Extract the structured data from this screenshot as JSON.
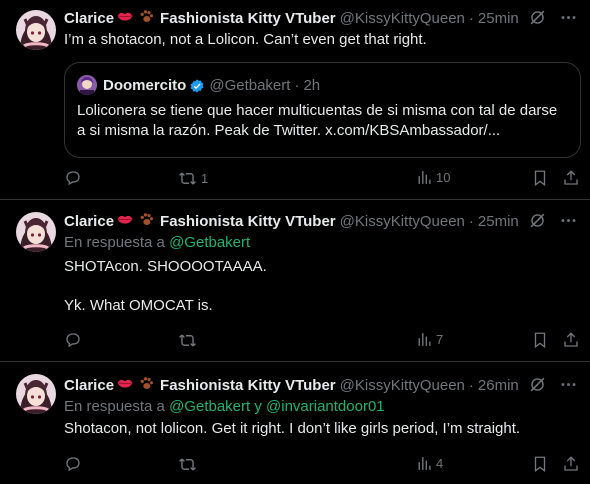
{
  "tweets": [
    {
      "author": {
        "name": "Clarice",
        "display_suffix": "Fashionista Kitty VTuber",
        "handle": "@KissyKittyQueen"
      },
      "time": "25min",
      "text": "I’m a shotacon, not a Lolicon.  Can’t even get that right.",
      "quote": {
        "author": "Doomercito",
        "handle": "@Getbakert",
        "time": "2h",
        "text": "Loliconera se tiene que hacer multicuentas de si misma con tal de darse a si misma la razón. Peak de Twitter. x.com/KBSAmbassador/..."
      },
      "stats": {
        "replies": "",
        "reposts": "1",
        "likes": "",
        "views": "10"
      }
    },
    {
      "author": {
        "name": "Clarice",
        "display_suffix": "Fashionista Kitty VTuber",
        "handle": "@KissyKittyQueen"
      },
      "time": "25min",
      "reply_prefix": "En respuesta a",
      "reply_mentions": "@Getbakert",
      "text_line1": "SHOTAcon.  SHOOOOTAAAA.",
      "text_line2": "Yk.  What OMOCAT is.",
      "stats": {
        "replies": "",
        "reposts": "",
        "likes": "",
        "views": "7"
      }
    },
    {
      "author": {
        "name": "Clarice",
        "display_suffix": "Fashionista Kitty VTuber",
        "handle": "@KissyKittyQueen"
      },
      "time": "26min",
      "reply_prefix": "En respuesta a",
      "reply_mentions": "@Getbakert y @invariantdoor01",
      "text": "Shotacon, not lolicon.  Get it right.  I don’t like girls period, I’m straight.",
      "stats": {
        "replies": "",
        "reposts": "",
        "likes": "",
        "views": "4"
      }
    }
  ],
  "colors": {
    "background": "#000000",
    "text": "#e7e9ea",
    "muted": "#71767b",
    "mention": "#1fb36f",
    "border": "#2f3336",
    "verified": "#1d9bf0"
  },
  "icons": [
    "grok-slash-icon",
    "more-icon",
    "reply-icon",
    "repost-icon",
    "like-icon",
    "views-icon",
    "bookmark-icon",
    "share-icon",
    "lips-emoji-icon",
    "paw-emoji-icon",
    "verified-badge-icon"
  ]
}
